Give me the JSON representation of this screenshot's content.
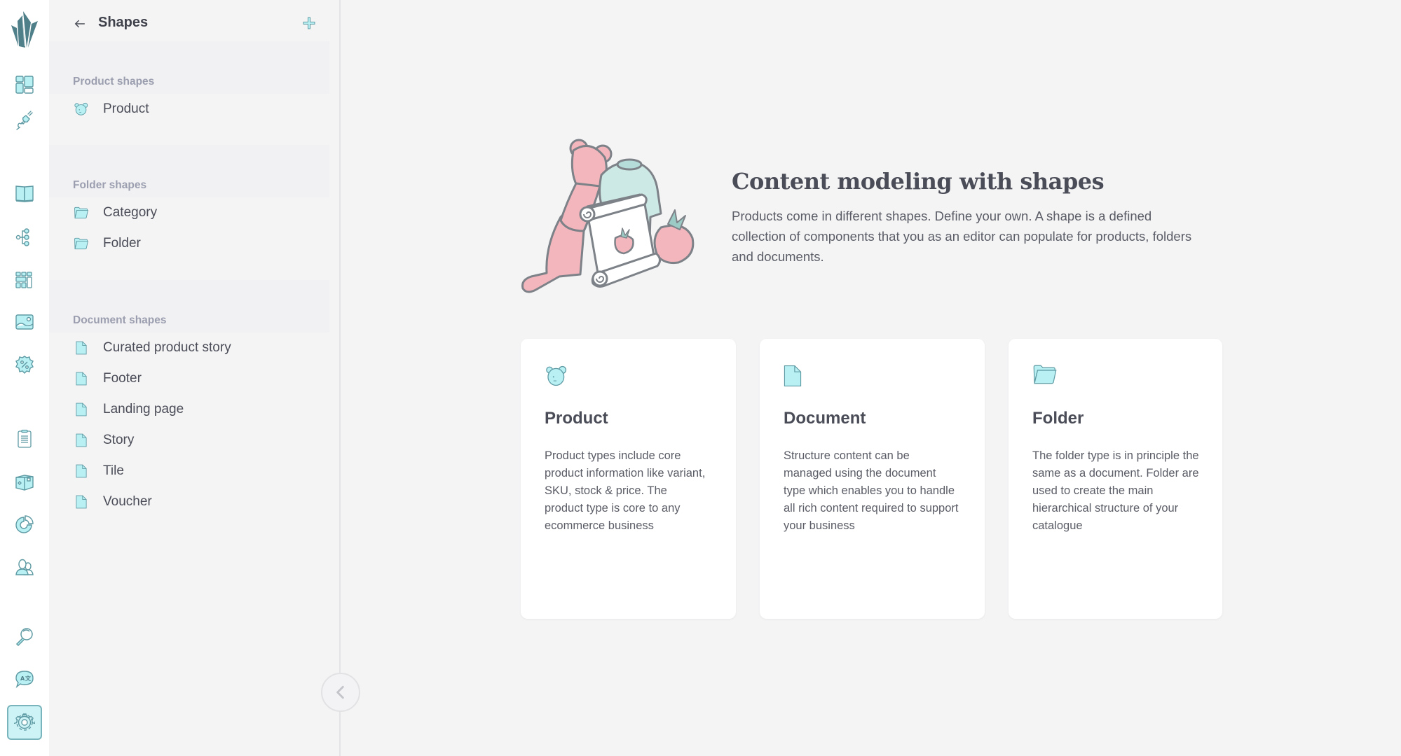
{
  "colors": {
    "accent": "#b8f0f4",
    "accent_stroke": "#5e9aa3",
    "logo": "#4f7f89",
    "text": "#4a4c57",
    "muted": "#9b9eaf",
    "background": "#f4f4f5"
  },
  "rail": {
    "logo_icon": "crystallize-logo",
    "items": [
      {
        "icon": "dashboard-icon"
      },
      {
        "icon": "plug-icon"
      },
      {
        "icon": "catalogue-book-icon"
      },
      {
        "icon": "topics-tree-icon"
      },
      {
        "icon": "grids-icon"
      },
      {
        "icon": "image-gallery-icon"
      },
      {
        "icon": "discount-badge-icon"
      },
      {
        "icon": "orders-clipboard-icon"
      },
      {
        "icon": "subscription-box-icon"
      },
      {
        "icon": "analytics-pie-icon"
      },
      {
        "icon": "customers-icon"
      },
      {
        "icon": "search-icon"
      },
      {
        "icon": "translate-icon"
      },
      {
        "icon": "settings-gear-icon",
        "active": true
      }
    ]
  },
  "sidebar": {
    "title": "Shapes",
    "back_icon": "arrow-left-icon",
    "add_icon": "plus-icon",
    "sections": [
      {
        "heading": "Product shapes",
        "items": [
          {
            "label": "Product",
            "icon": "bear-icon"
          }
        ]
      },
      {
        "heading": "Folder shapes",
        "items": [
          {
            "label": "Category",
            "icon": "folder-icon"
          },
          {
            "label": "Folder",
            "icon": "folder-icon"
          }
        ]
      },
      {
        "heading": "Document shapes",
        "items": [
          {
            "label": "Curated product story",
            "icon": "document-icon"
          },
          {
            "label": "Footer",
            "icon": "document-icon"
          },
          {
            "label": "Landing page",
            "icon": "document-icon"
          },
          {
            "label": "Story",
            "icon": "document-icon"
          },
          {
            "label": "Tile",
            "icon": "document-icon"
          },
          {
            "label": "Voucher",
            "icon": "document-icon"
          }
        ]
      }
    ],
    "collapse_icon": "chevron-left-icon"
  },
  "main": {
    "hero": {
      "illustration": "shapes-illustration",
      "title": "Content modeling with shapes",
      "description": "Products come in different shapes. Define your own. A shape is a defined collection of components that you as an editor can populate for products, folders and documents."
    },
    "cards": [
      {
        "icon": "bear-icon",
        "title": "Product",
        "description": "Product types include core product information like variant, SKU, stock & price. The product type is core to any ecommerce business"
      },
      {
        "icon": "document-icon",
        "title": "Document",
        "description": "Structure content can be managed using the document type which enables you to handle all rich content required to support your business"
      },
      {
        "icon": "folder-icon",
        "title": "Folder",
        "description": "The folder type is in principle the same as a document. Folder are used to create the main hierarchical structure of your catalogue"
      }
    ]
  }
}
